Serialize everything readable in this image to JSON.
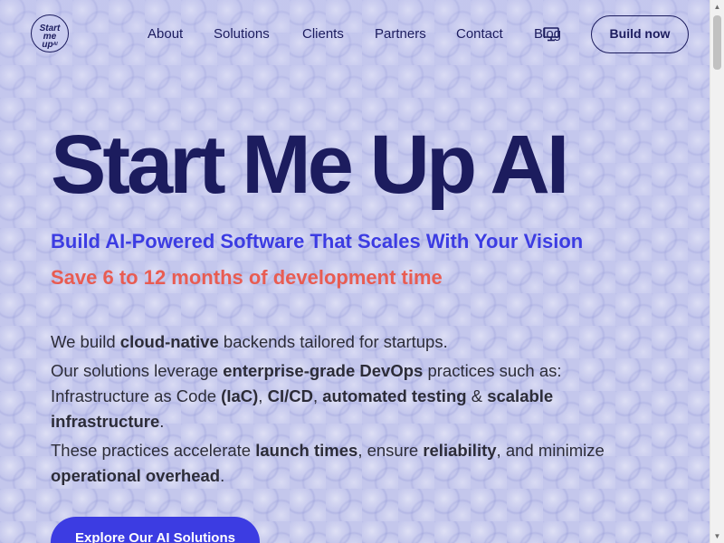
{
  "brand": {
    "logo_line1": "Start",
    "logo_line2": "me",
    "logo_line3": "up",
    "logo_mark": "AI"
  },
  "nav": {
    "links": [
      "About",
      "Solutions",
      "Clients",
      "Partners",
      "Contact",
      "Blog"
    ],
    "icon": "monitor-icon",
    "build_label": "Build now"
  },
  "hero": {
    "title": "Start Me Up AI",
    "subtitle": "Build AI-Powered Software That Scales With Your Vision",
    "tagline": "Save 6 to 12 months of development time"
  },
  "body": {
    "p1": [
      "We build ",
      "cloud-native",
      " backends tailored for startups."
    ],
    "p2": [
      "Our solutions leverage ",
      "enterprise-grade DevOps",
      " practices such as: Infrastructure as Code ",
      "(IaC)",
      ", ",
      "CI/CD",
      ", ",
      "automated testing",
      " & ",
      "scalable infrastructure",
      "."
    ],
    "p3": [
      "These practices accelerate ",
      "launch times",
      ", ensure ",
      "reliability",
      ", and minimize ",
      "operational overhead",
      "."
    ]
  },
  "cta": {
    "label": "Explore Our AI Solutions"
  },
  "colors": {
    "navy": "#1c1c5e",
    "accent_blue": "#3c3ce2",
    "accent_coral": "#e85c52",
    "background": "#c5c8ec"
  }
}
